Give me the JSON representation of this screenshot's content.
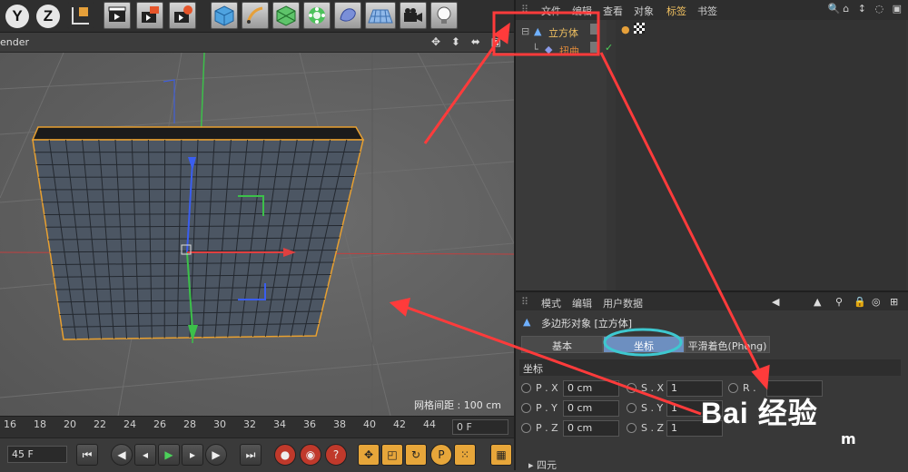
{
  "toolbar": {
    "axis_buttons": [
      "Y",
      "Z"
    ],
    "icons": [
      "coordinate-system-icon",
      "render-view-icon",
      "render-to-picture-viewer-icon",
      "render-settings-icon",
      "cube-primitive-icon",
      "pen-spline-icon",
      "subdivision-surface-icon",
      "cloner-icon",
      "deformer-icon",
      "floor-icon",
      "camera-icon",
      "light-icon"
    ]
  },
  "viewport": {
    "title": "ender",
    "nav_icons": "✥ ⬍ ⬌ ▣",
    "grid_label": "网格间距 : 100 cm"
  },
  "timeline": {
    "ticks": [
      "16",
      "18",
      "20",
      "22",
      "24",
      "26",
      "28",
      "30",
      "32",
      "34",
      "36",
      "38",
      "40",
      "42",
      "44"
    ],
    "end_frame": "0 F",
    "current_frame": "45 F"
  },
  "object_manager": {
    "menu": [
      "文件",
      "编辑",
      "查看",
      "对象",
      "标签",
      "书签"
    ],
    "active_menu": "标签",
    "objects": [
      {
        "name": "立方体",
        "color": "#f0c060"
      },
      {
        "name": "扭曲",
        "color": "#e08a3a"
      }
    ]
  },
  "attribute_manager": {
    "menu": [
      "模式",
      "编辑",
      "用户数据"
    ],
    "title": "多边形对象 [立方体]",
    "tabs": [
      "基本",
      "坐标",
      "平滑着色(Phong)"
    ],
    "active_tab": "坐标",
    "section": "坐标",
    "rows": [
      {
        "p_label": "P . X",
        "p_value": "0 cm",
        "s_label": "S . X",
        "s_value": "1",
        "r_label": "R ."
      },
      {
        "p_label": "P . Y",
        "p_value": "0 cm",
        "s_label": "S . Y",
        "s_value": "1",
        "r_label": ""
      },
      {
        "p_label": "P . Z",
        "p_value": "0 cm",
        "s_label": "S . Z",
        "s_value": "1",
        "r_label": ""
      }
    ],
    "quaternion": "▸ 四元"
  },
  "watermark": {
    "text": "Bai 经验",
    "sub": "m"
  },
  "colors": {
    "highlight": "#ff3b3b",
    "tab_active": "#6d8fc0",
    "object_outline": "#e8a030"
  }
}
